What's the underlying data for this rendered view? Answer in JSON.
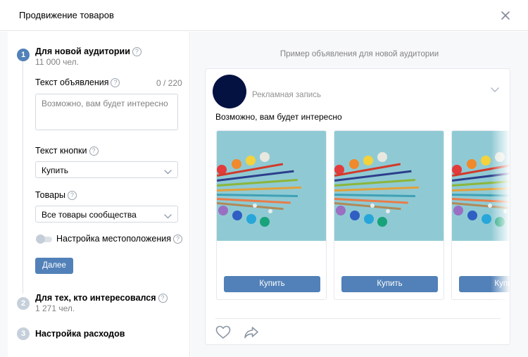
{
  "header": {
    "title": "Продвижение товаров"
  },
  "steps": [
    {
      "num": "1",
      "title": "Для новой аудитории",
      "sub": "11 000 чел."
    },
    {
      "num": "2",
      "title": "Для тех, кто интересовался",
      "sub": "1 271 чел."
    },
    {
      "num": "3",
      "title": "Настройка расходов"
    }
  ],
  "form": {
    "ad_text_label": "Текст объявления",
    "ad_text_counter": "0 / 220",
    "ad_text_placeholder": "Возможно, вам будет интересно",
    "button_text_label": "Текст кнопки",
    "button_text_value": "Купить",
    "products_label": "Товары",
    "products_value": "Все товары сообщества",
    "location_label": "Настройка местоположения",
    "next_button": "Далее"
  },
  "preview": {
    "caption": "Пример объявления для новой аудитории",
    "ad_label": "Рекламная запись",
    "text": "Возможно, вам будет интересно",
    "cards": [
      {
        "button": "Купить"
      },
      {
        "button": "Купить"
      },
      {
        "button": "Купить"
      }
    ]
  },
  "colors": {
    "accent": "#5181b8",
    "avatar": "#041242",
    "photo_bg": "#8ec9d3"
  }
}
